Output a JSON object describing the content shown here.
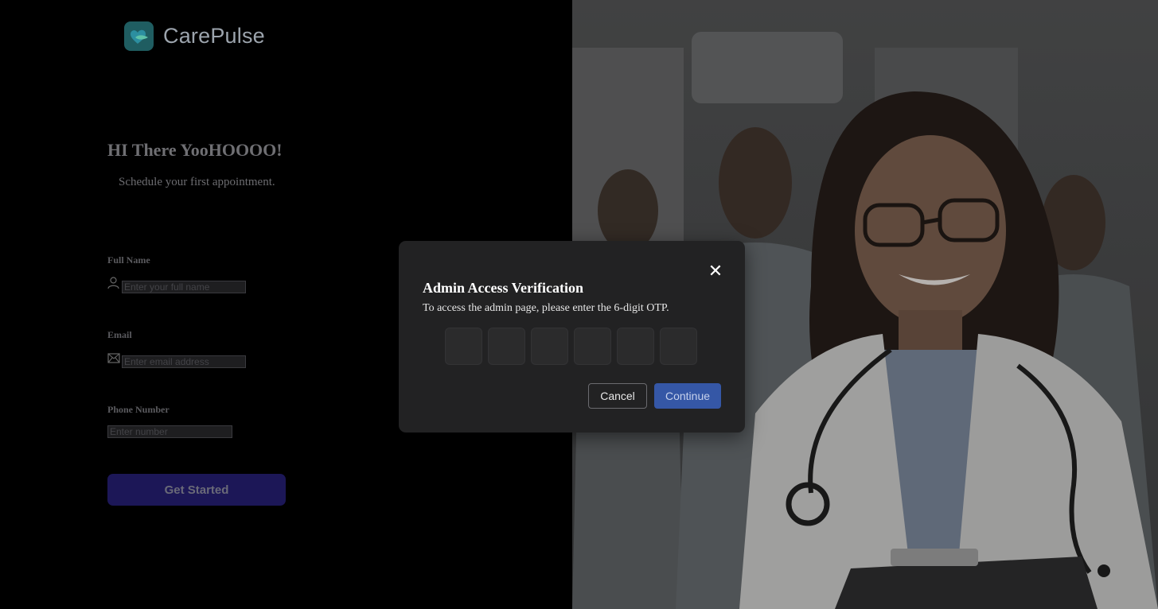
{
  "brand": {
    "name": "CarePulse"
  },
  "hero": {
    "title": "HI There YooHOOOO!",
    "subtitle": "Schedule your first appointment."
  },
  "form": {
    "full_name": {
      "label": "Full Name",
      "placeholder": "Enter your full name",
      "icon": "user-icon"
    },
    "email": {
      "label": "Email",
      "placeholder": "Enter email address",
      "icon": "mail-icon"
    },
    "phone": {
      "label": "Phone Number",
      "placeholder": "Enter number"
    },
    "submit_label": "Get Started"
  },
  "modal": {
    "title": "Admin Access Verification",
    "description": "To access the admin page, please enter the 6-digit OTP.",
    "close_icon": "close-icon",
    "otp_digits": [
      "",
      "",
      "",
      "",
      "",
      ""
    ],
    "cancel_label": "Cancel",
    "continue_label": "Continue"
  },
  "colors": {
    "accent": "#3557a6",
    "cta": "#1c1757",
    "modal_bg": "#222223"
  }
}
